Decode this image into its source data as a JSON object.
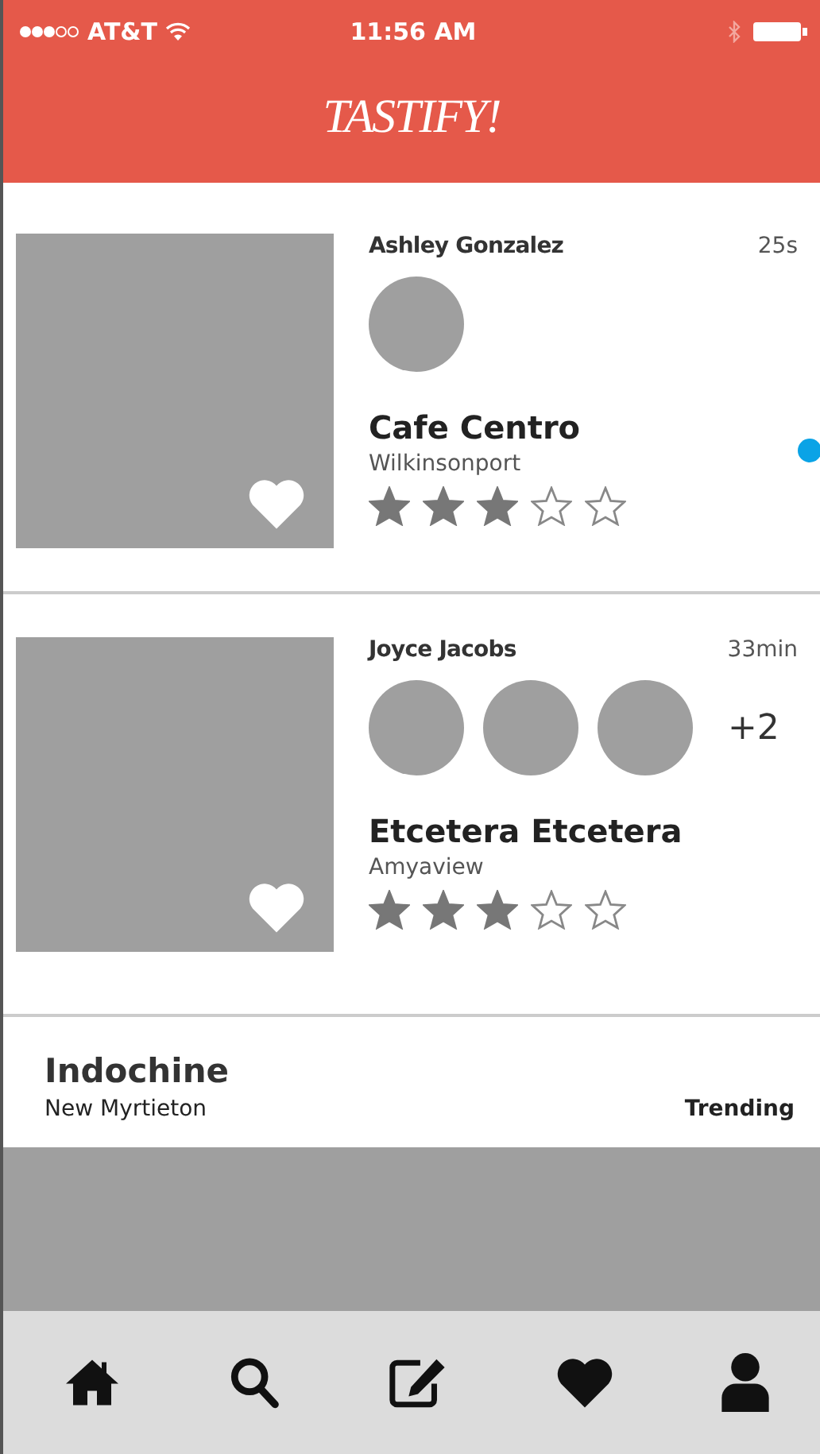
{
  "status_bar": {
    "carrier": "AT&T",
    "time": "11:56 AM"
  },
  "header": {
    "logo": "TASTIFY!"
  },
  "feed": [
    {
      "user": "Ashley Gonzalez",
      "time": "25s",
      "avatars": [
        {
          "kind": "circle"
        }
      ],
      "restaurant": "Cafe Centro",
      "city": "Wilkinsonport",
      "stars": 3
    },
    {
      "user": "Joyce Jacobs",
      "time": "33min",
      "avatars": [
        {
          "kind": "circle"
        },
        {
          "kind": "circle"
        },
        {
          "kind": "circle"
        }
      ],
      "more": "+2",
      "restaurant": "Etcetera Etcetera",
      "city": "Amyaview",
      "stars": 3
    }
  ],
  "trending": {
    "restaurant": "Indochine",
    "city": "New Myrtieton",
    "tag": "Trending"
  },
  "tab_bar": [
    {
      "kind": "home"
    },
    {
      "kind": "search"
    },
    {
      "kind": "compose"
    },
    {
      "kind": "heart"
    },
    {
      "kind": "profile"
    }
  ]
}
